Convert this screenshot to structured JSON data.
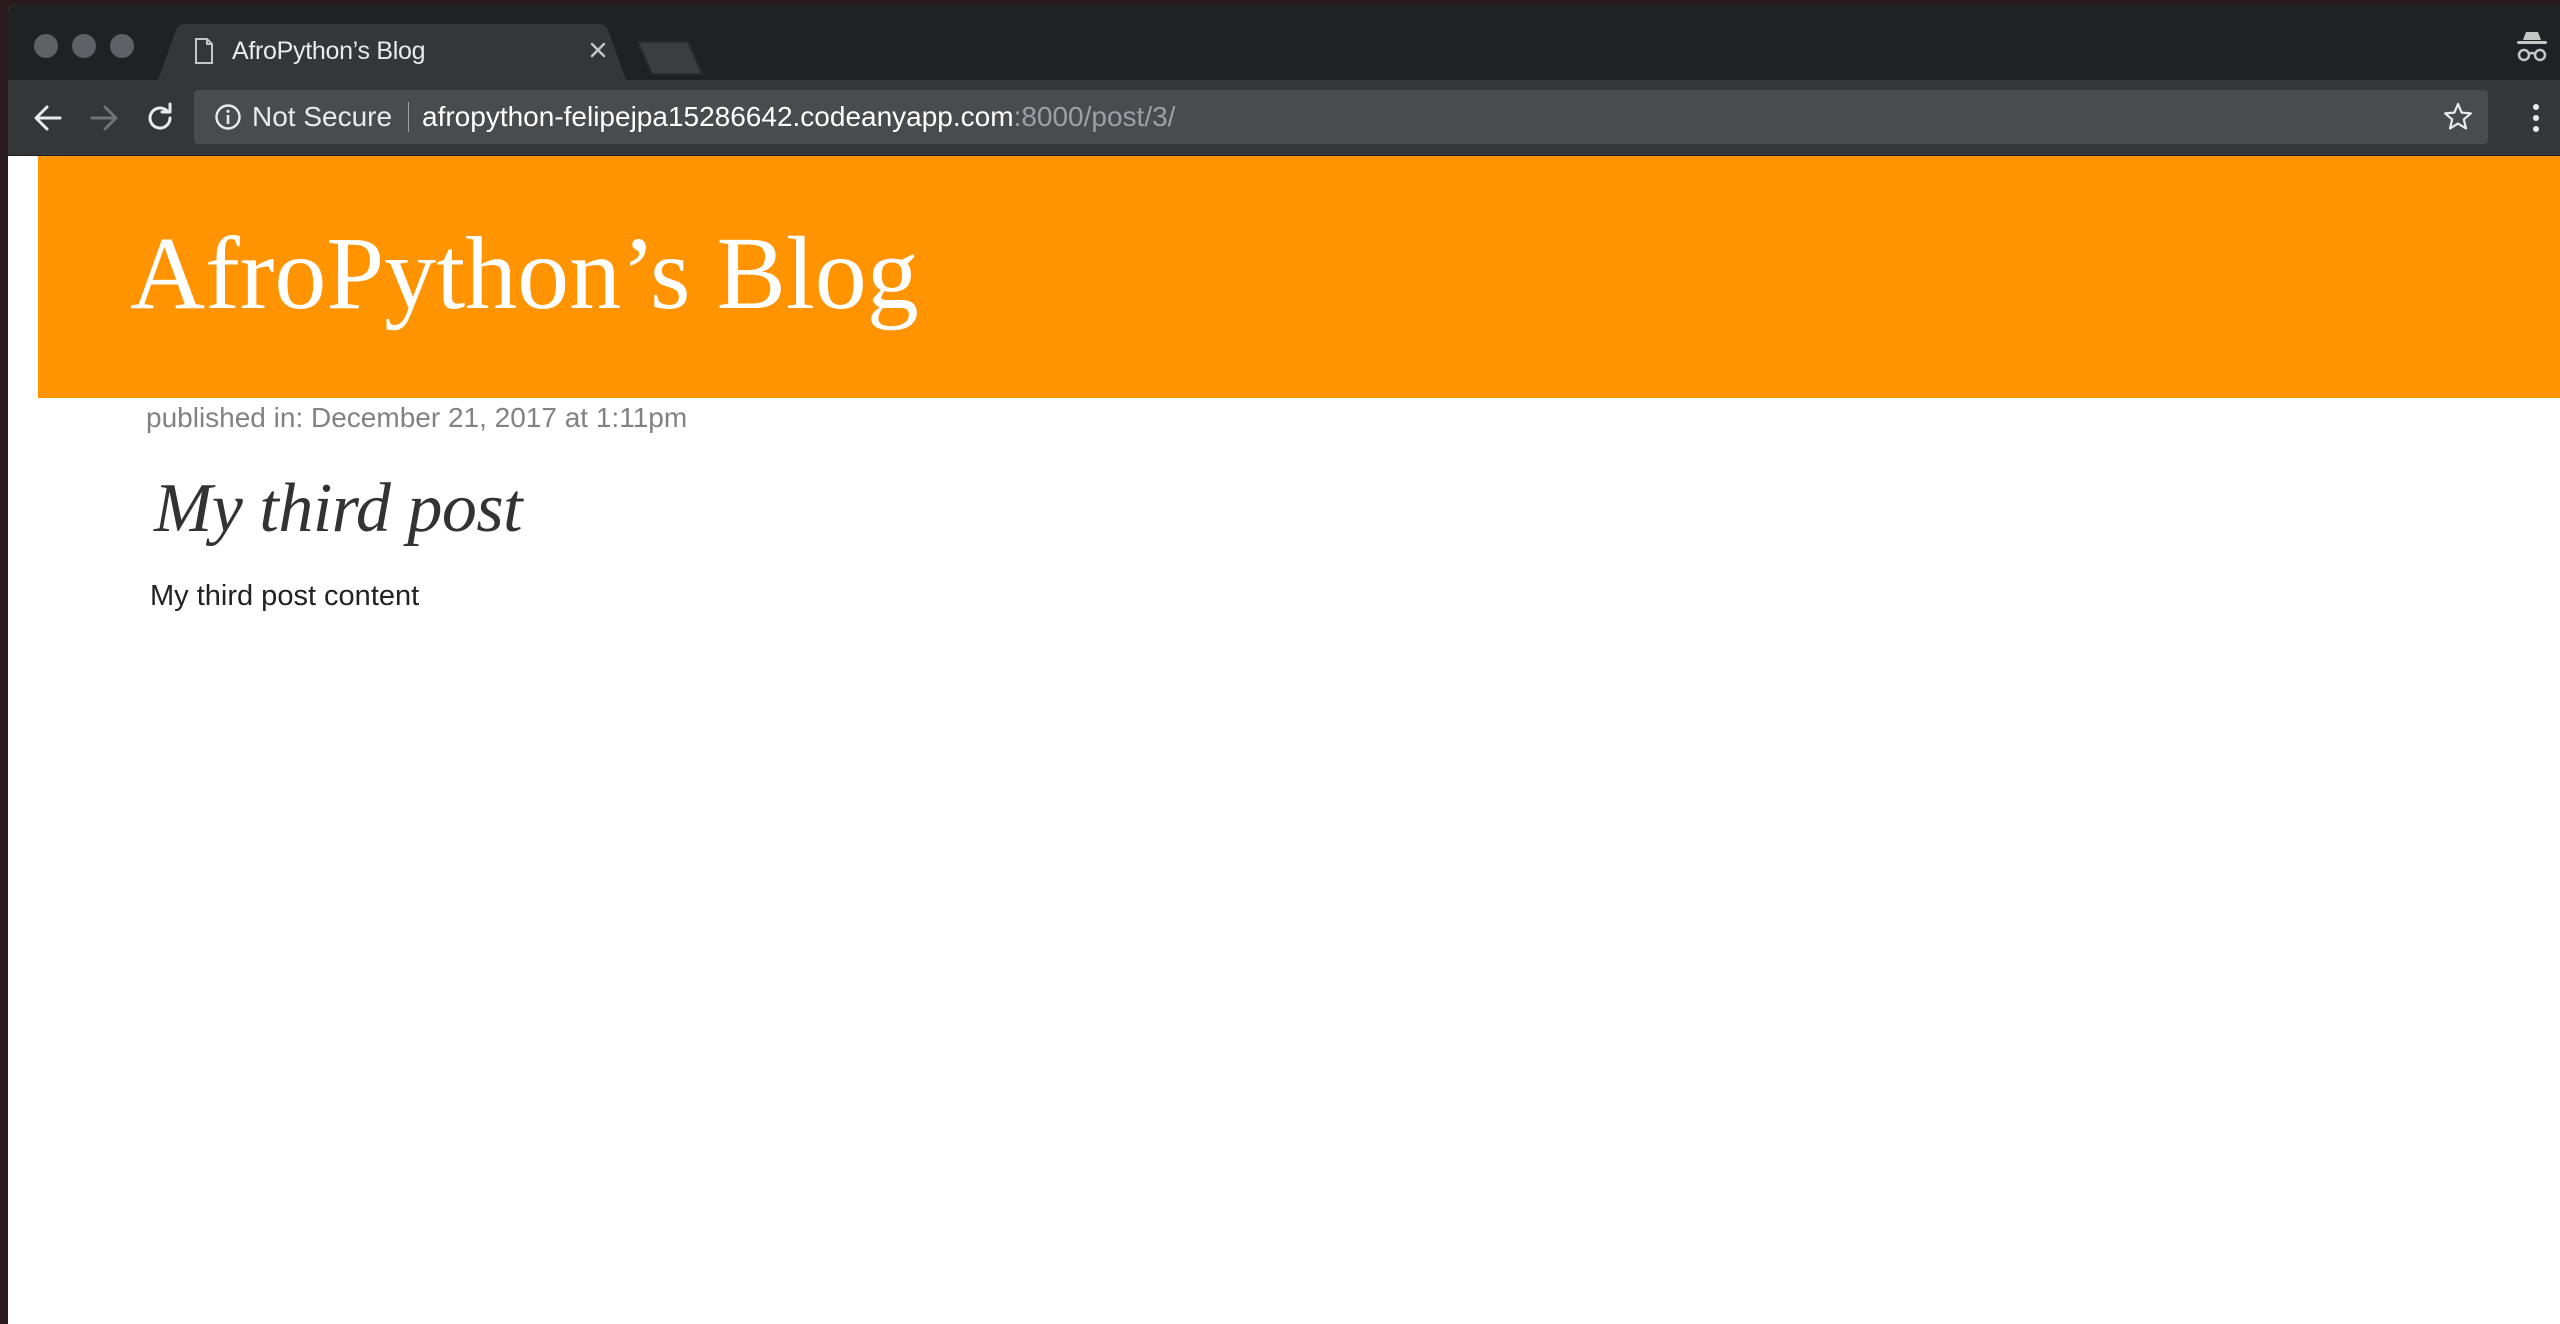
{
  "browser": {
    "tab": {
      "title": "AfroPython’s Blog"
    },
    "toolbar": {
      "security_label": "Not Secure",
      "url_host": "afropython-felipejpa15286642.codeanyapp.com",
      "url_rest": ":8000/post/3/"
    },
    "icons": {
      "back": "arrow-left-icon",
      "forward": "arrow-right-icon",
      "reload": "reload-icon",
      "info": "info-icon",
      "bookmark": "star-icon",
      "menu": "kebab-menu-icon",
      "incognito": "incognito-icon",
      "tab_page": "document-icon",
      "tab_close": "close-icon"
    }
  },
  "blog": {
    "title": "AfroPython’s Blog",
    "header_color": "#ff9400"
  },
  "post": {
    "published": "published in: December 21, 2017 at 1:11pm",
    "title": "My third post",
    "content": "My third post content"
  }
}
